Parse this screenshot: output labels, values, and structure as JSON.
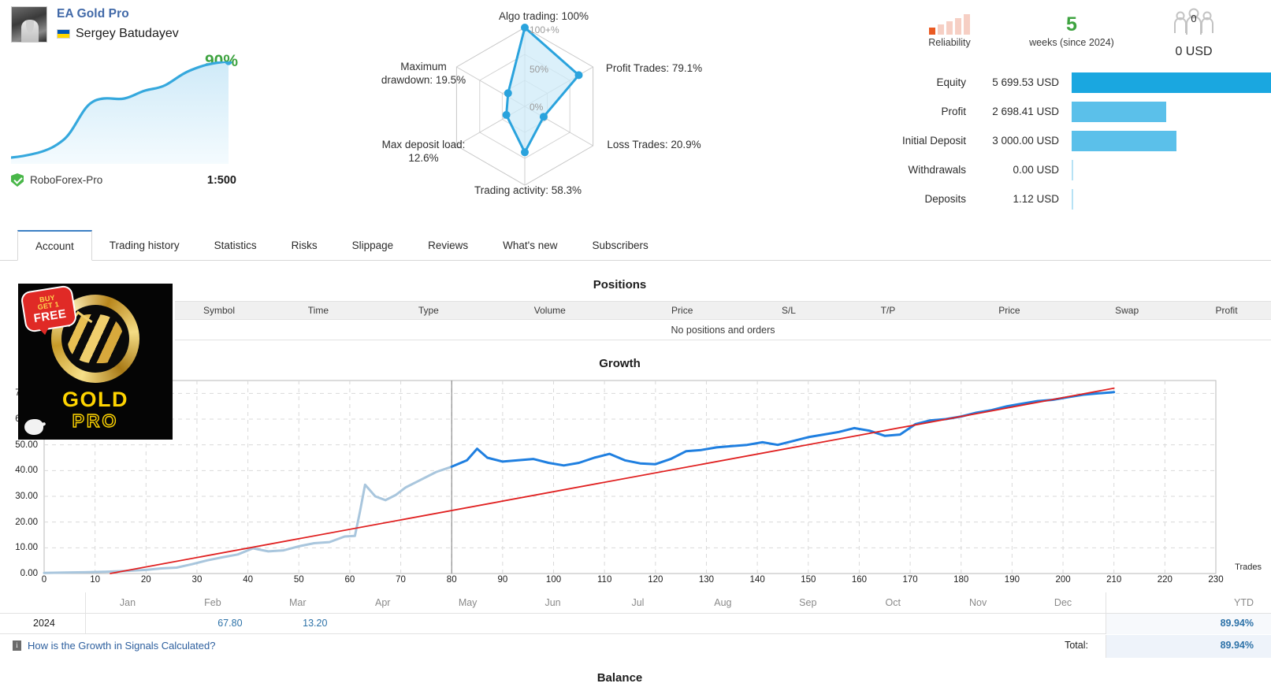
{
  "signal": {
    "title": "EA Gold Pro",
    "author": "Sergey Batudayev",
    "growth_pct": "90%",
    "broker": "RoboForex-Pro",
    "leverage": "1:500"
  },
  "radar": {
    "labels": {
      "algo_trading": "Algo trading: 100%",
      "profit_trades": "Profit Trades: 79.1%",
      "loss_trades": "Loss Trades: 20.9%",
      "trading_activity": "Trading activity: 58.3%",
      "max_deposit_load": "Max deposit load: 12.6%",
      "max_drawdown": "Maximum drawdown: 19.5%"
    },
    "rings": {
      "outer": "100+%",
      "mid": "50%",
      "inner": "0%"
    },
    "values": {
      "algo_trading": 100,
      "profit_trades": 79.1,
      "loss_trades": 20.9,
      "trading_activity": 58.3,
      "max_deposit_load": 12.6,
      "max_drawdown": 19.5
    },
    "accent": "#2aa3dd"
  },
  "badges": {
    "reliability_label": "Reliability",
    "reliability_filled": 1,
    "reliability_total": 5,
    "weeks_value": "5",
    "weeks_label": "weeks (since 2024)",
    "subscribers_count": "0",
    "subscribers_usd": "0 USD"
  },
  "account": {
    "rows": [
      {
        "name": "Equity",
        "value": "5 699.53 USD",
        "bar_pct": 100,
        "style": "strong"
      },
      {
        "name": "Profit",
        "value": "2 698.41 USD",
        "bar_pct": 47.3,
        "style": "light"
      },
      {
        "name": "Initial Deposit",
        "value": "3 000.00 USD",
        "bar_pct": 52.6,
        "style": "light"
      },
      {
        "name": "Withdrawals",
        "value": "0.00 USD",
        "bar_pct": 0,
        "style": "nil"
      },
      {
        "name": "Deposits",
        "value": "1.12 USD",
        "bar_pct": 0,
        "style": "nil"
      }
    ]
  },
  "tabs": [
    {
      "label": "Account",
      "active": true
    },
    {
      "label": "Trading history",
      "active": false
    },
    {
      "label": "Statistics",
      "active": false
    },
    {
      "label": "Risks",
      "active": false
    },
    {
      "label": "Slippage",
      "active": false
    },
    {
      "label": "Reviews",
      "active": false
    },
    {
      "label": "What's new",
      "active": false
    },
    {
      "label": "Subscribers",
      "active": false
    }
  ],
  "positions": {
    "title": "Positions",
    "columns": [
      "Symbol",
      "Time",
      "Type",
      "Volume",
      "Price",
      "S/L",
      "T/P",
      "Price",
      "Swap",
      "Profit"
    ],
    "empty_text": "No positions and orders"
  },
  "growth": {
    "title": "Growth",
    "trades_axis_label": "Trades",
    "months": [
      "Jan",
      "Feb",
      "Mar",
      "Apr",
      "May",
      "Jun",
      "Jul",
      "Aug",
      "Sep",
      "Oct",
      "Nov",
      "Dec"
    ],
    "ytd_header": "YTD",
    "year_row": {
      "year": "2024",
      "monthly": {
        "Jan": "",
        "Feb": "67.80",
        "Mar": "13.20",
        "Apr": "",
        "May": "",
        "Jun": "",
        "Jul": "",
        "Aug": "",
        "Sep": "",
        "Oct": "",
        "Nov": "",
        "Dec": ""
      },
      "ytd": "89.94%"
    },
    "total_label": "Total:",
    "total_value": "89.94%",
    "calc_link": "How is the Growth in Signals Calculated?"
  },
  "bottom_partial_title": "Balance",
  "ad": {
    "badge_line1": "BUY",
    "badge_line2": "GET 1",
    "badge_line3": "FREE",
    "gold": "GOLD",
    "pro": "PRO"
  },
  "chart_data": {
    "type": "line",
    "title": "Growth",
    "xlabel": "Trades",
    "ylabel": "",
    "xlim": [
      0,
      230
    ],
    "ylim": [
      0,
      75
    ],
    "xticks": [
      0,
      10,
      20,
      30,
      40,
      50,
      60,
      70,
      80,
      90,
      100,
      110,
      120,
      130,
      140,
      150,
      160,
      170,
      180,
      190,
      200,
      210,
      220,
      230
    ],
    "yticks": [
      0.0,
      10.0,
      20.0,
      30.0,
      40.0,
      50.0,
      60.0,
      70.0
    ],
    "ytick_labels": [
      "0.00",
      "10.00",
      "20.00",
      "30.00",
      "40.00",
      "50.00",
      "60.00",
      "70.00"
    ],
    "grid": true,
    "legend": "none",
    "series": [
      {
        "name": "Growth (historical)",
        "color": "#a9c6dd",
        "x": [
          0,
          4,
          8,
          12,
          16,
          20,
          23,
          26,
          29,
          32,
          35,
          38,
          41,
          44,
          47,
          50,
          53,
          56,
          59,
          61,
          62,
          63,
          65,
          67,
          69,
          71,
          74,
          77,
          80
        ],
        "y": [
          0.2,
          0.4,
          0.5,
          0.7,
          1.0,
          1.4,
          2.0,
          2.3,
          3.6,
          5.1,
          6.3,
          7.4,
          9.8,
          8.6,
          9.0,
          10.6,
          11.8,
          12.2,
          14.4,
          14.6,
          24.0,
          34.5,
          30.0,
          28.5,
          30.5,
          33.5,
          36.5,
          39.5,
          41.5
        ]
      },
      {
        "name": "Growth (recent)",
        "color": "#1f7fe0",
        "x": [
          80,
          83,
          85,
          87,
          90,
          93,
          96,
          99,
          102,
          105,
          108,
          111,
          114,
          117,
          120,
          123,
          126,
          129,
          132,
          135,
          138,
          141,
          144,
          147,
          150,
          153,
          156,
          159,
          162,
          165,
          168,
          171,
          174,
          177,
          180,
          183,
          186,
          189,
          192,
          195,
          198,
          201,
          204,
          207,
          210
        ],
        "y": [
          41.5,
          44.0,
          48.5,
          45.0,
          43.5,
          44.0,
          44.5,
          43.0,
          42.0,
          43.0,
          45.0,
          46.5,
          44.0,
          42.8,
          42.5,
          44.5,
          47.5,
          48.0,
          49.0,
          49.5,
          50.0,
          51.0,
          50.0,
          51.5,
          53.0,
          54.0,
          55.0,
          56.5,
          55.5,
          53.5,
          54.0,
          58.0,
          59.5,
          60.0,
          61.0,
          62.5,
          63.5,
          65.0,
          66.0,
          67.0,
          67.5,
          68.5,
          69.5,
          70.0,
          70.5
        ]
      },
      {
        "name": "Trend",
        "color": "#e02020",
        "x": [
          13,
          210
        ],
        "y": [
          0.0,
          72.0
        ]
      }
    ],
    "annotations": [
      {
        "type": "vline",
        "x": 80,
        "color": "#7a7a7a"
      }
    ]
  },
  "sparkline": {
    "color": "#35a8dd",
    "fill": "#dff1fb",
    "points": [
      2,
      4,
      7,
      14,
      30,
      46,
      52,
      56,
      62,
      70,
      80,
      88,
      96,
      100
    ]
  }
}
